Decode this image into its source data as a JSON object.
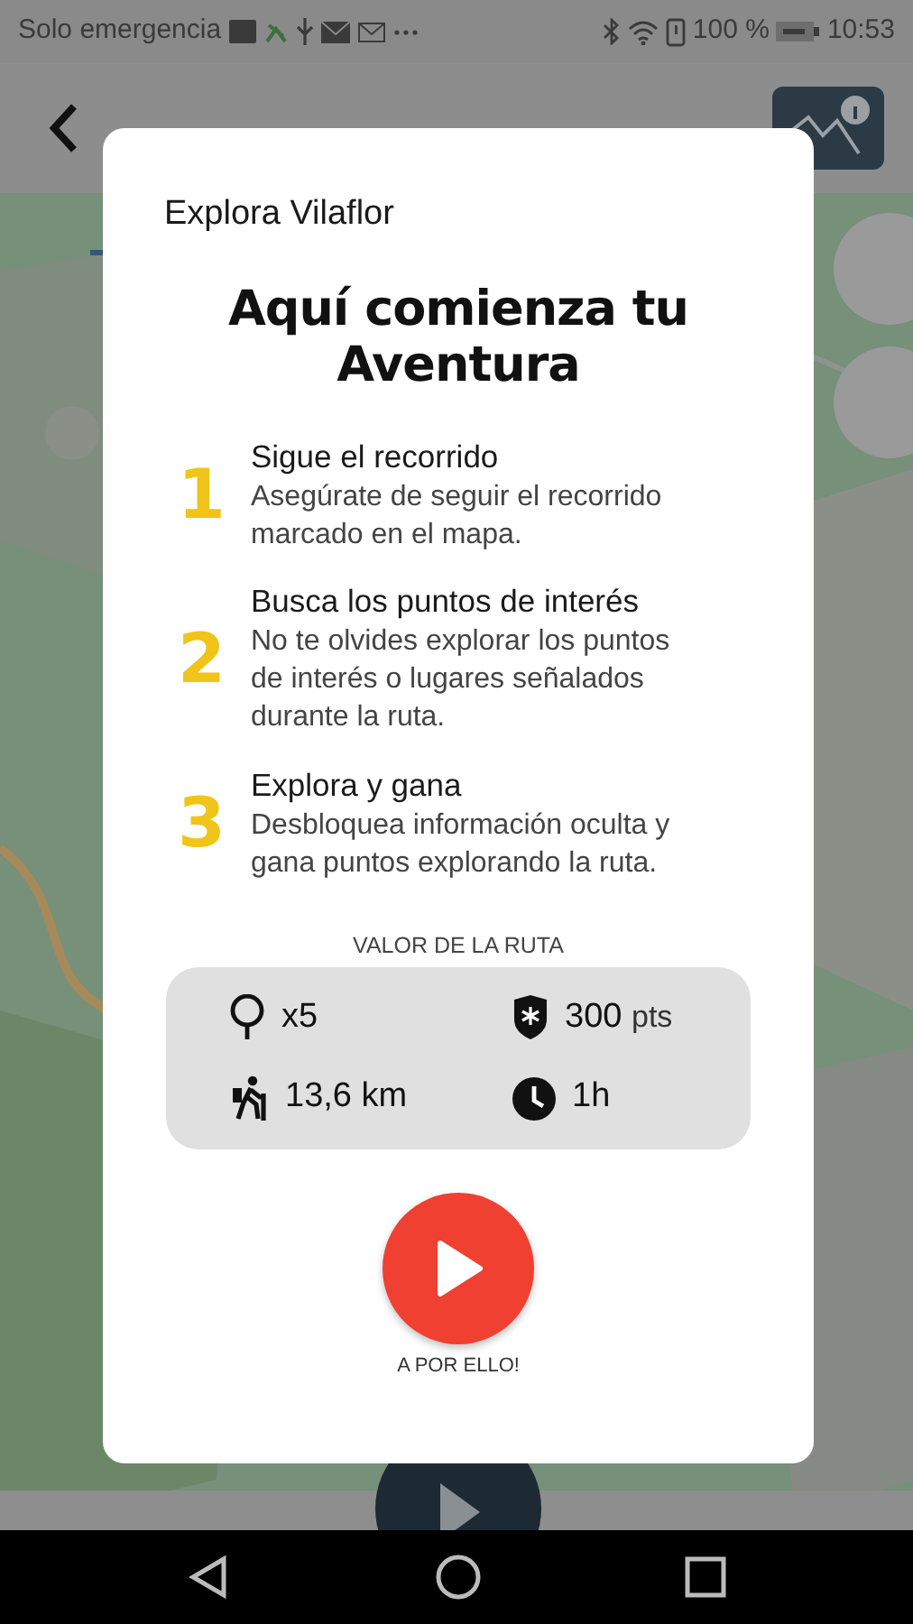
{
  "status_bar": {
    "carrier": "Solo emergencia",
    "battery": "100 %",
    "time": "10:53"
  },
  "dialog": {
    "subtitle": "Explora Vilaflor",
    "title": "Aquí comienza tu Aventura",
    "steps": [
      {
        "number": "1",
        "title": "Sigue el recorrido",
        "text": "Asegúrate de seguir el recorrido marcado en el mapa."
      },
      {
        "number": "2",
        "title": "Busca los puntos de interés",
        "text": "No te olvides explorar los puntos de interés o lugares señalados durante la ruta."
      },
      {
        "number": "3",
        "title": "Explora y gana",
        "text": "Desbloquea información oculta y gana puntos explorando la ruta."
      }
    ],
    "route_value": {
      "label": "VALOR DE LA RUTA",
      "stats": [
        {
          "kind": "places",
          "value": "x5"
        },
        {
          "kind": "points",
          "value": "300",
          "unit": "pts"
        },
        {
          "kind": "distance",
          "value": "13,6 km"
        },
        {
          "kind": "duration",
          "value": "1h"
        }
      ]
    },
    "start_button": {
      "label": "A POR ELLO!"
    }
  }
}
